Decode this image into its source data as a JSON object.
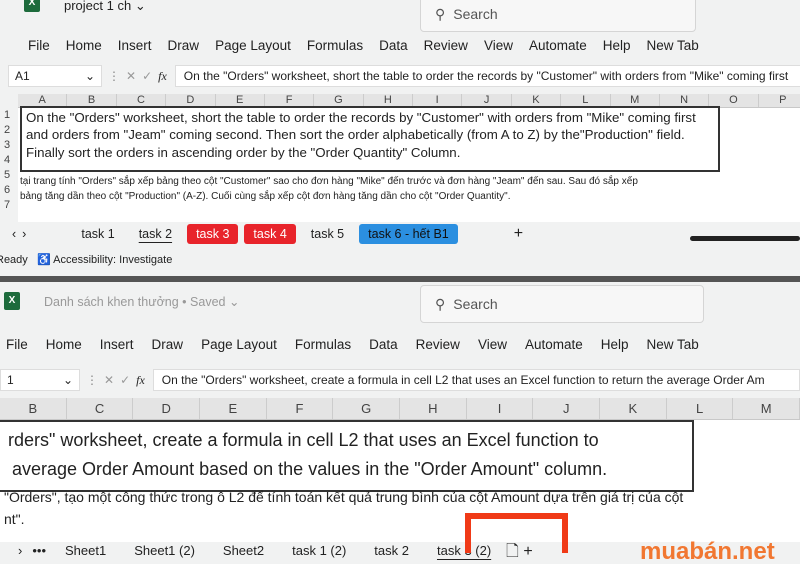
{
  "top": {
    "title": "project 1 ch",
    "search": "Search",
    "menu": [
      "File",
      "Home",
      "Insert",
      "Draw",
      "Page Layout",
      "Formulas",
      "Data",
      "Review",
      "View",
      "Automate",
      "Help",
      "New Tab"
    ],
    "name_box": "A1",
    "formula": "On the \"Orders\" worksheet, short the table to order the records by \"Customer\" with orders from \"Mike\" coming first",
    "columns": [
      "A",
      "B",
      "C",
      "D",
      "E",
      "F",
      "G",
      "H",
      "I",
      "J",
      "K",
      "L",
      "M",
      "N",
      "O",
      "P"
    ],
    "rows": [
      "1",
      "2",
      "3",
      "4",
      "5",
      "6",
      "7"
    ],
    "merged_lines": [
      "On the \"Orders\" worksheet, short the table to order the records by \"Customer\" with orders from \"Mike\" coming first",
      "and orders from \"Jeam\" coming second. Then sort the order alphabetically (from A to Z) by the\"Production\" field.",
      "Finally sort the orders in ascending order by the \"Order Quantity\" Column."
    ],
    "vn_lines": [
      "tại trang tính \"Orders\" sắp xếp bảng theo cột \"Customer\" sao cho đơn hàng \"Mike\" đến trước và đơn hàng \"Jeam\" đến sau. Sau đó sắp xếp",
      "bảng tăng dần theo cột \"Production\" (A-Z). Cuối cùng sắp xếp cột đơn hàng tăng dần cho cột \"Order Quantity\"."
    ],
    "tabs": [
      {
        "label": "task 1",
        "style": "plain"
      },
      {
        "label": "task 2",
        "style": "active"
      },
      {
        "label": "task 3",
        "style": "red"
      },
      {
        "label": "task 4",
        "style": "red"
      },
      {
        "label": "task 5",
        "style": "plain"
      },
      {
        "label": "task 6 - hết B1",
        "style": "blue"
      }
    ],
    "status": "Ready",
    "accessibility": "Accessibility: Investigate"
  },
  "bottom": {
    "title": "Danh sách khen thưởng • Saved",
    "search": "Search",
    "menu": [
      "File",
      "Home",
      "Insert",
      "Draw",
      "Page Layout",
      "Formulas",
      "Data",
      "Review",
      "View",
      "Automate",
      "Help",
      "New Tab"
    ],
    "name_box": "1",
    "formula": "On the \"Orders\" worksheet, create a formula in cell L2 that uses an Excel function to return the average Order Am",
    "columns": [
      "B",
      "C",
      "D",
      "E",
      "F",
      "G",
      "H",
      "I",
      "J",
      "K",
      "L",
      "M"
    ],
    "merged_lines": [
      "rders\" worksheet, create a formula in cell L2 that uses an Excel function to",
      "average Order Amount based on the values in the \"Order Amount\" column."
    ],
    "vn_lines": [
      "\"Orders\", tạo một công thức trong ô L2 để tính toán kết quả trung bình của cột Amount dựa trên giá trị của cột",
      "nt\"."
    ],
    "tabs": [
      {
        "label": "Sheet1",
        "style": "plain"
      },
      {
        "label": "Sheet1 (2)",
        "style": "plain"
      },
      {
        "label": "Sheet2",
        "style": "plain"
      },
      {
        "label": "task 1 (2)",
        "style": "plain"
      },
      {
        "label": "task 2",
        "style": "plain"
      },
      {
        "label": "task 3 (2)",
        "style": "active"
      }
    ]
  },
  "watermark": "muabán.net",
  "highlight_color": "#f03a17"
}
